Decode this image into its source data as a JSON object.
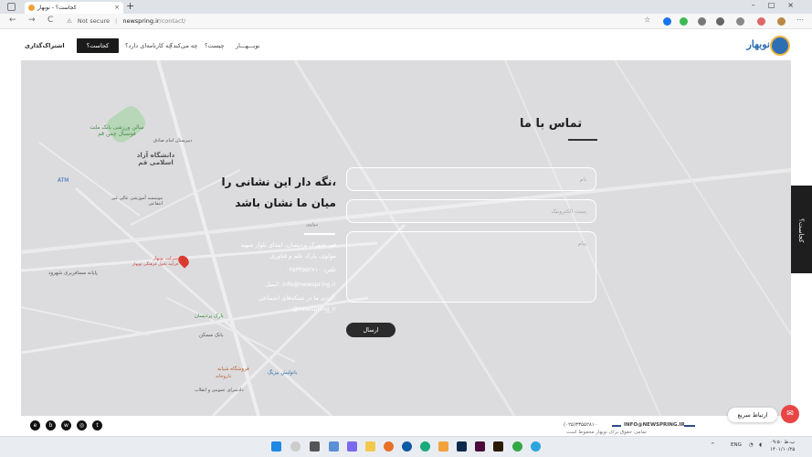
{
  "browser": {
    "tab_title": "کجاست؟ - نوبهار",
    "tab_close": "×",
    "new_tab": "+",
    "nav_back": "←",
    "nav_forward": "→",
    "nav_reload": "C",
    "security": "Not secure",
    "url_host": "newspring.ir",
    "url_path": "/contact/",
    "window_controls": "–□×"
  },
  "header": {
    "logo_text": "نوبهار",
    "contact_button": "کجاست؟",
    "subscribe": "اشتراک‌گذاری",
    "nav": [
      "نوبـــهـــار",
      "چیست؟",
      "چه می‌کند؟",
      "چه کارنامه‌ای دارد؟"
    ]
  },
  "contact": {
    "title": "تماس با ما",
    "name_placeholder": "نام",
    "email_placeholder": "پست الکترونیک",
    "message_placeholder": "پیام",
    "send_button": "ارسال",
    "headline_1": "نگه دار این نشانی را،",
    "headline_2": "میان ما نشان باشد",
    "small_label": "مولوی",
    "address_1": "قم، شهرک پردیسان، ابتدای بلوار شهید",
    "address_2": "مولوی، پارک علم و فناوری",
    "phone": "تلفن: ۰۲۵۳۳۵۵۲۸۱۰",
    "email": "ایمیل: info@newspring.ir",
    "social_1": "آی‌دی ما در شبکه‌های اجتماعی:",
    "social_2": "@newspring_ir"
  },
  "map_labels": {
    "university": "دانشگاه آزاد اسلامی قم",
    "sports": "سالن ورزشی بانک ملت فوتسال چمن قم",
    "atm": "ATM",
    "institute": "موسسه آموزشی عالی غیر انتفاعی",
    "school": "دبیرستان امام صادق",
    "marker": "شرکت نوبهار",
    "marker_sub": "فرآیند تحول فرهنگی نوبهار",
    "hotel": "پایانه مسافربری شهرود",
    "park": "پارک پردیسان",
    "bank": "بانک مسکن",
    "store": "فروشگاه شبانه",
    "pharmacy": "داروخانه",
    "hospital": "بانولیش بیزیگ",
    "court": "دادسرای عمومی و انقلاب"
  },
  "side_tab": "کجاست؟",
  "footer": {
    "copyright": "تمامی حقوق برای نوبهار محفوظ است",
    "email": "INFO@NEWSPRING.IR",
    "phone": "(۰۲۵)۳۳۵۵۲۸۱۰",
    "quick_contact": "ارتباط سریع"
  },
  "taskbar": {
    "lang": "ENG",
    "time": "۰۹:۵۰ ب.ظ",
    "date": "۱۴۰۱/۱۰/۲۵"
  },
  "colors": {
    "accent_dark": "#1a1a1a",
    "brand_blue": "#2d6fb3",
    "brand_gold": "#f3b541",
    "chat_red": "#e84545"
  }
}
